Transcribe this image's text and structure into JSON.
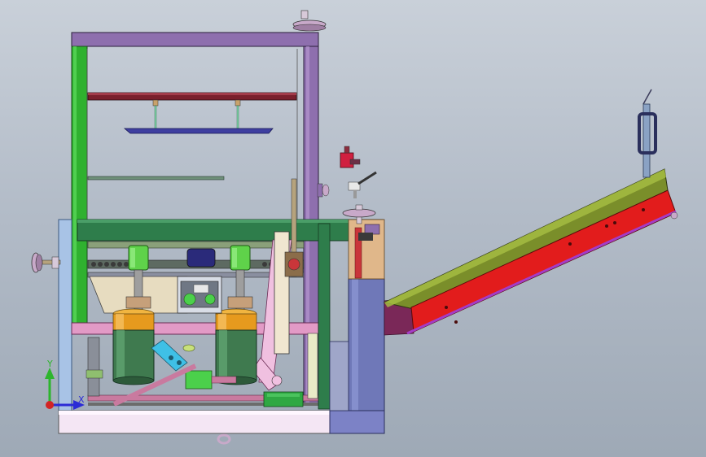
{
  "viewport": {
    "background_top": "#c9d0d9",
    "background_bottom": "#9ea9b6"
  },
  "triad": {
    "y_label": "Y",
    "x_label": "X",
    "y_color": "#2db52d",
    "x_color": "#2b2bd6",
    "z_color": "#d22424"
  },
  "colors": {
    "frame_purple": "#8e6fae",
    "frame_purple_dark": "#5a3f74",
    "upright_green": "#2fb12f",
    "cross_rail_maroon": "#7a1f2c",
    "motor_green": "#3f7a4f",
    "motor_orange": "#e69a1e",
    "cylinder_lime": "#5fd24a",
    "conveyor_olive": "#7a8e2a",
    "conveyor_red": "#e21c1c",
    "pink_frame": "#e29ac6",
    "blue_box": "#6f78b8",
    "light_blue": "#a8c3e6",
    "handwheel": "#c8a9c9"
  }
}
